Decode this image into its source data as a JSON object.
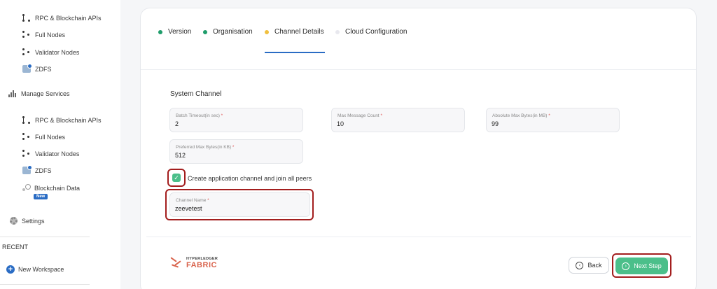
{
  "sidebar": {
    "top_items": [
      {
        "label": "RPC & Blockchain APIs",
        "icon": "network-icon"
      },
      {
        "label": "Full Nodes",
        "icon": "nodes-icon"
      },
      {
        "label": "Validator Nodes",
        "icon": "validator-icon"
      },
      {
        "label": "ZDFS",
        "icon": "zdfs-icon"
      }
    ],
    "manage_services": {
      "label": "Manage Services",
      "icon": "bar-chart-icon"
    },
    "service_items": [
      {
        "label": "RPC & Blockchain APIs",
        "icon": "network-icon"
      },
      {
        "label": "Full Nodes",
        "icon": "nodes-icon"
      },
      {
        "label": "Validator Nodes",
        "icon": "validator-icon"
      },
      {
        "label": "ZDFS",
        "icon": "zdfs-icon"
      },
      {
        "label": "Blockchain Data",
        "icon": "chain-icon",
        "badge": "New"
      }
    ],
    "settings": {
      "label": "Settings",
      "icon": "gear-icon"
    },
    "recent_heading": "RECENT",
    "new_workspace": {
      "label": "New Workspace",
      "icon": "plus-circle-icon"
    }
  },
  "tabs": [
    {
      "label": "Version",
      "color": "#1f9d6b"
    },
    {
      "label": "Organisation",
      "color": "#1f9d6b"
    },
    {
      "label": "Channel Details",
      "color": "#f0c040",
      "active": true
    },
    {
      "label": "Cloud Configuration",
      "color": "#e8e8ee"
    }
  ],
  "form": {
    "section_title": "System Channel",
    "fields": {
      "batch_timeout": {
        "label": "Batch Timeout(in sec)",
        "required": "*",
        "value": "2"
      },
      "max_message_count": {
        "label": "Max Message Count",
        "required": "*",
        "value": "10"
      },
      "absolute_max_bytes": {
        "label": "Absolute Max Bytes(in MB)",
        "required": "*",
        "value": "99"
      },
      "preferred_max_bytes": {
        "label": "Preferred Max Bytes(in KB)",
        "required": "*",
        "value": "512"
      }
    },
    "create_channel_checkbox": {
      "label": "Create application channel and join all peers",
      "checked": true
    },
    "channel_name": {
      "label": "Channel Name",
      "required": "*",
      "value": "zeevetest"
    }
  },
  "footer": {
    "logo": {
      "line1": "HYPERLEDGER",
      "line2": "FABRIC"
    },
    "back_label": "Back",
    "next_label": "Next Step"
  },
  "colors": {
    "accent_green": "#4bbf8a",
    "highlight_red": "#a31e1e",
    "accent_blue": "#2a6cc4"
  }
}
